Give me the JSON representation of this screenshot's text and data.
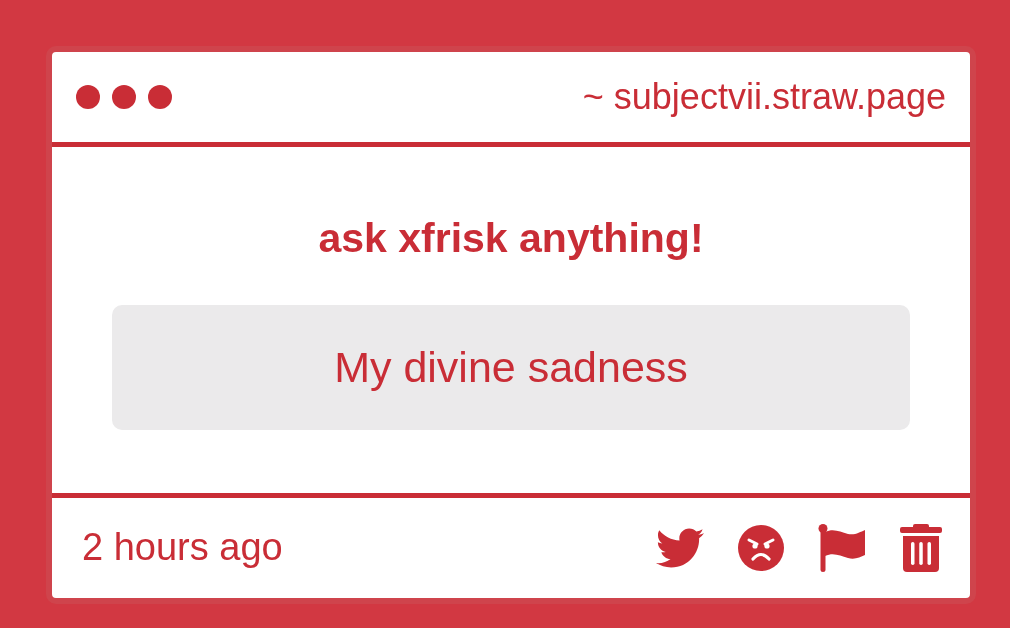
{
  "header": {
    "url": "~ subjectvii.straw.page"
  },
  "prompt": {
    "title": "ask xfrisk anything!"
  },
  "question": {
    "text": "My divine sadness"
  },
  "footer": {
    "time": "2 hours ago"
  }
}
